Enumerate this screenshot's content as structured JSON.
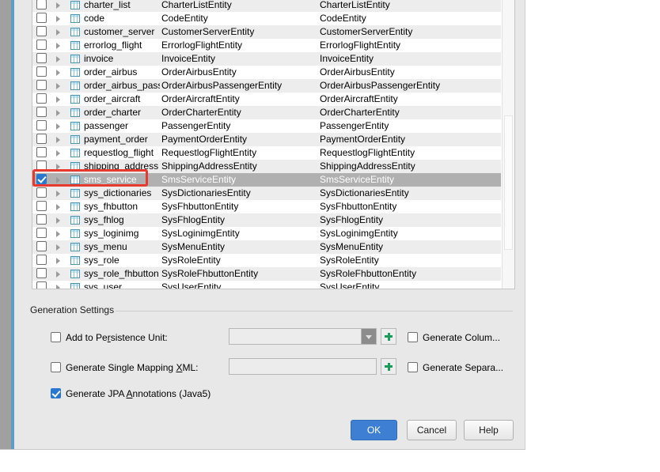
{
  "dialog": {
    "table_columns": [
      "selected",
      "expand",
      "icon",
      "table_name",
      "class_name",
      "class_name_2"
    ],
    "tables": [
      {
        "checked": false,
        "name": "charter_list",
        "class": "CharterListEntity",
        "class2": "CharterListEntity"
      },
      {
        "checked": false,
        "name": "code",
        "class": "CodeEntity",
        "class2": "CodeEntity"
      },
      {
        "checked": false,
        "name": "customer_server",
        "class": "CustomerServerEntity",
        "class2": "CustomerServerEntity"
      },
      {
        "checked": false,
        "name": "errorlog_flight",
        "class": "ErrorlogFlightEntity",
        "class2": "ErrorlogFlightEntity"
      },
      {
        "checked": false,
        "name": "invoice",
        "class": "InvoiceEntity",
        "class2": "InvoiceEntity"
      },
      {
        "checked": false,
        "name": "order_airbus",
        "class": "OrderAirbusEntity",
        "class2": "OrderAirbusEntity"
      },
      {
        "checked": false,
        "name": "order_airbus_pass",
        "class": "OrderAirbusPassengerEntity",
        "class2": "OrderAirbusPassengerEntity"
      },
      {
        "checked": false,
        "name": "order_aircraft",
        "class": "OrderAircraftEntity",
        "class2": "OrderAircraftEntity"
      },
      {
        "checked": false,
        "name": "order_charter",
        "class": "OrderCharterEntity",
        "class2": "OrderCharterEntity"
      },
      {
        "checked": false,
        "name": "passenger",
        "class": "PassengerEntity",
        "class2": "PassengerEntity"
      },
      {
        "checked": false,
        "name": "payment_order",
        "class": "PaymentOrderEntity",
        "class2": "PaymentOrderEntity"
      },
      {
        "checked": false,
        "name": "requestlog_flight",
        "class": "RequestlogFlightEntity",
        "class2": "RequestlogFlightEntity"
      },
      {
        "checked": false,
        "name": "shipping_address",
        "class": "ShippingAddressEntity",
        "class2": "ShippingAddressEntity"
      },
      {
        "checked": true,
        "name": "sms_service",
        "class": "SmsServiceEntity",
        "class2": "SmsServiceEntity",
        "selected": true
      },
      {
        "checked": false,
        "name": "sys_dictionaries",
        "class": "SysDictionariesEntity",
        "class2": "SysDictionariesEntity"
      },
      {
        "checked": false,
        "name": "sys_fhbutton",
        "class": "SysFhbuttonEntity",
        "class2": "SysFhbuttonEntity"
      },
      {
        "checked": false,
        "name": "sys_fhlog",
        "class": "SysFhlogEntity",
        "class2": "SysFhlogEntity"
      },
      {
        "checked": false,
        "name": "sys_loginimg",
        "class": "SysLoginimgEntity",
        "class2": "SysLoginimgEntity"
      },
      {
        "checked": false,
        "name": "sys_menu",
        "class": "SysMenuEntity",
        "class2": "SysMenuEntity"
      },
      {
        "checked": false,
        "name": "sys_role",
        "class": "SysRoleEntity",
        "class2": "SysRoleEntity"
      },
      {
        "checked": false,
        "name": "sys_role_fhbutton",
        "class": "SysRoleFhbuttonEntity",
        "class2": "SysRoleFhbuttonEntity"
      },
      {
        "checked": false,
        "name": "sys_user",
        "class": "SysUserEntity",
        "class2": "SysUserEntity"
      }
    ],
    "generation_settings": {
      "title": "Generation Settings",
      "add_to_persistence_unit": {
        "label_pre": "Add to Pe",
        "label_accel": "r",
        "label_post": "sistence Unit:",
        "checked": false
      },
      "persistence_unit_value": "",
      "generate_single_mapping_xml": {
        "label_pre": "Generate Single Mapping ",
        "label_accel": "X",
        "label_post": "ML:",
        "checked": false
      },
      "single_mapping_xml_value": "",
      "generate_jpa_annotations": {
        "label_pre": "Generate JPA ",
        "label_accel": "A",
        "label_post": "nnotations (Java5)",
        "checked": true
      },
      "generate_columns": {
        "label": "Generate Colum...",
        "checked": false
      },
      "generate_separate": {
        "label": "Generate Separa...",
        "checked": false
      },
      "add_persistence_unit_button": "+",
      "add_mapping_xml_button": "+"
    },
    "buttons": {
      "ok": "OK",
      "cancel": "Cancel",
      "help": "Help"
    }
  },
  "annotation": {
    "color": "#e8392e",
    "target": "sms_service"
  }
}
